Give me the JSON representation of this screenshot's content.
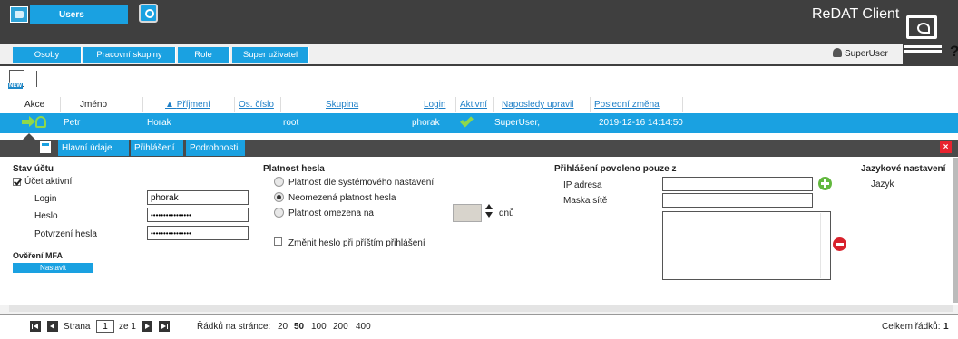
{
  "header": {
    "users_tab": "Users",
    "app_title": "ReDAT Client",
    "subtabs": [
      "Osoby",
      "Pracovní skupiny",
      "Role",
      "Super uživatel"
    ],
    "current_user": "SuperUser",
    "help": "?"
  },
  "table": {
    "columns": [
      "Akce",
      "Jméno",
      "Příjmení",
      "Os. číslo",
      "Skupina",
      "Login",
      "Aktivní",
      "Naposledy upravil",
      "Poslední změna"
    ],
    "row": {
      "jmeno": "Petr",
      "prijmeni": "Horak",
      "skupina": "root",
      "login": "phorak",
      "naposledy_upravil": "SuperUser,",
      "posledni_zmena": "2019-12-16 14:14:50"
    }
  },
  "detail": {
    "tabs": [
      "Hlavní údaje",
      "Přihlášení",
      "Podrobnosti"
    ],
    "close": "×",
    "account": {
      "title": "Stav účtu",
      "active_label": "Účet aktivní",
      "login_label": "Login",
      "login_value": "phorak",
      "password_label": "Heslo",
      "password_value": "••••••••••••••••",
      "confirm_label": "Potvrzení hesla",
      "confirm_value": "••••••••••••••••",
      "mfa_title": "Ověření MFA",
      "mfa_button": "Nastavit"
    },
    "validity": {
      "title": "Platnost hesla",
      "options": [
        "Platnost dle systémového nastavení",
        "Neomezená platnost hesla",
        "Platnost omezena na"
      ],
      "days_unit": "dnů",
      "change_next": "Změnit heslo při příštím přihlášení"
    },
    "login_from": {
      "title": "Přihlášení povoleno pouze z",
      "ip_label": "IP adresa",
      "mask_label": "Maska sítě"
    },
    "language": {
      "title": "Jazykové nastavení",
      "label": "Jazyk"
    }
  },
  "footer": {
    "page_label": "Strana",
    "page_value": "1",
    "page_of": "ze 1",
    "rows_label": "Řádků na stránce:",
    "rows_options": [
      "20",
      "50",
      "100",
      "200",
      "400"
    ],
    "total_label": "Celkem řádků:",
    "total_value": "1"
  }
}
